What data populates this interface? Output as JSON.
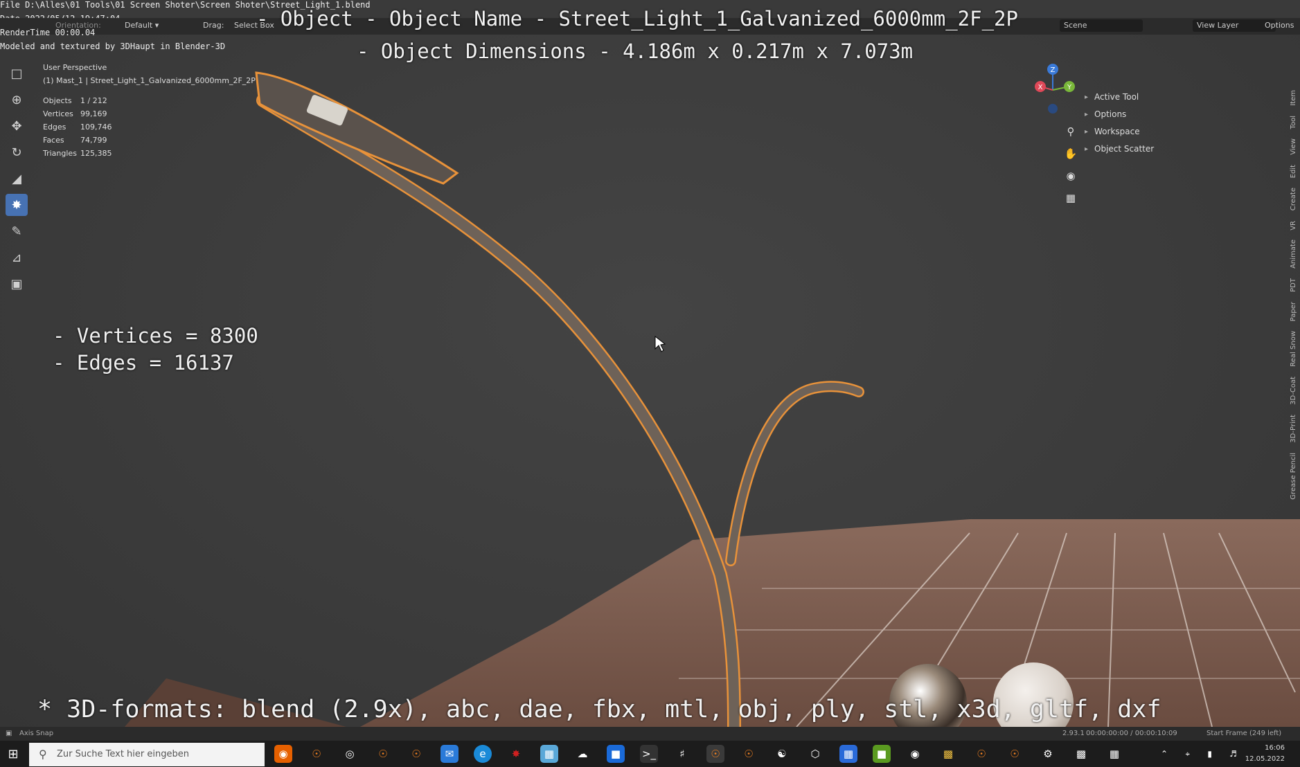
{
  "overlay": {
    "file_path": "File D:\\Alles\\01 Tools\\01 Screen Shoter\\Screen Shoter\\Street_Light_1.blend",
    "date": "Date 2022/05/12 19:47:04",
    "render_time": "RenderTime 00:00.04",
    "modeled_by": "Modeled and textured by 3DHaupt in Blender-3D",
    "object_name_line": "- Object - Object Name - Street_Light_1_Galvanized_6000mm_2F_2P",
    "object_dims_line": "- Object Dimensions -  4.186m x 0.217m x 7.073m",
    "vertices_line": "- Vertices = 8300",
    "edges_line": "- Edges = 16137",
    "formats_line": "* 3D-formats: blend (2.9x), abc, dae, fbx, mtl, obj, ply, stl, x3d, gltf, dxf"
  },
  "header": {
    "orientation": "Orientation:",
    "default": "Default",
    "drag": "Drag:",
    "select_box": "Select Box",
    "scene": "Scene",
    "view_layer": "View Layer",
    "options": "Options"
  },
  "viewport": {
    "perspective": "User Perspective",
    "active_object": "(1) Mast_1 | Street_Light_1_Galvanized_6000mm_2F_2P",
    "stats": [
      {
        "label": "Objects",
        "value": "1 / 212"
      },
      {
        "label": "Vertices",
        "value": "99,169"
      },
      {
        "label": "Edges",
        "value": "109,746"
      },
      {
        "label": "Faces",
        "value": "74,799"
      },
      {
        "label": "Triangles",
        "value": "125,385"
      }
    ],
    "gizmo": {
      "x": "X",
      "y": "Y",
      "z": "Z"
    }
  },
  "side_panel": {
    "items": [
      "Active Tool",
      "Options",
      "Workspace",
      "Object Scatter"
    ]
  },
  "vertical_tabs": [
    "Item",
    "Tool",
    "View",
    "Edit",
    "Create",
    "VR",
    "Animate",
    "PDT",
    "Paper",
    "Real Snow",
    "3D-Coat",
    "3D-Print",
    "Grease Pencil"
  ],
  "statusbar": {
    "axis_snap": "Axis Snap",
    "version": "2.93.1",
    "timecode": "00:00:00:00 / 00:00:10:09",
    "start_frame": "Start Frame (249 left)"
  },
  "taskbar": {
    "search_placeholder": "Zur Suche Text hier eingeben",
    "time": "16:06",
    "date": "12.05.2022"
  },
  "colors": {
    "selection_outline": "#e8923a",
    "active_tool": "#4772b3",
    "floor": "#7a5a4a"
  }
}
